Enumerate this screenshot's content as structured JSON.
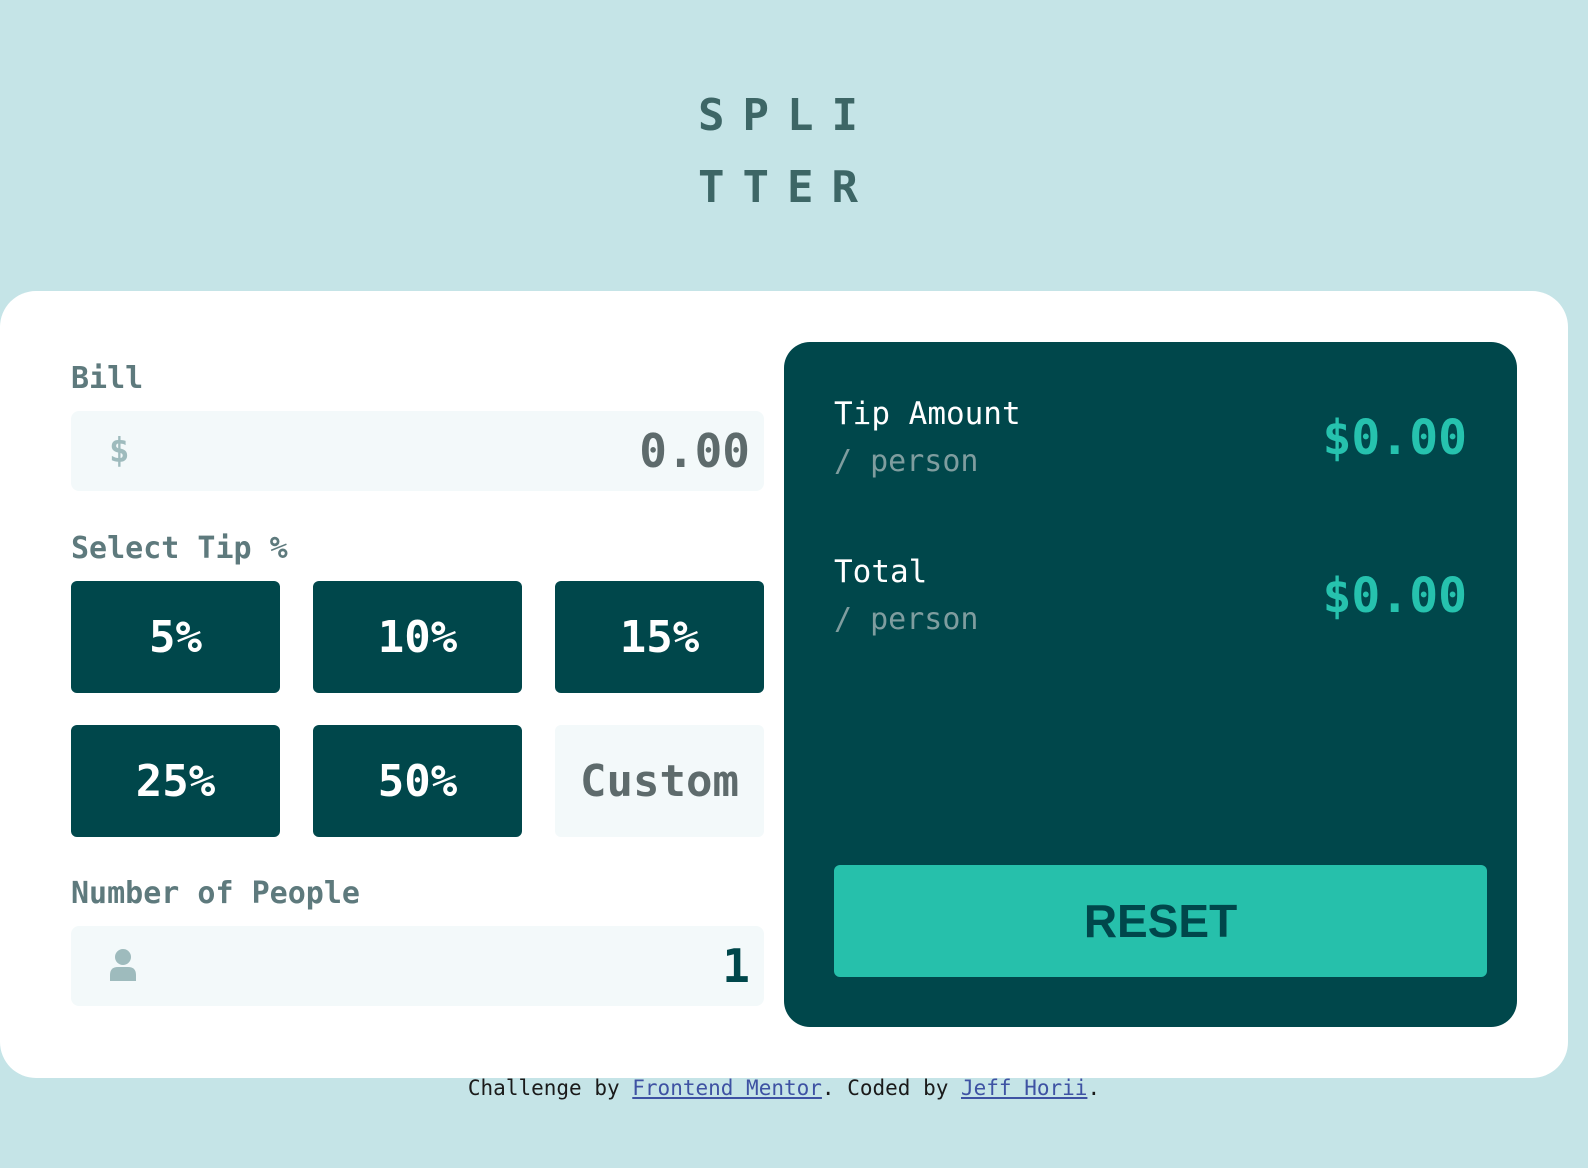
{
  "logo": {
    "line1": "SPLI",
    "line2": "TTER"
  },
  "bill": {
    "label": "Bill",
    "icon": "dollar-icon",
    "icon_glyph": "$",
    "value": "0.00"
  },
  "tip": {
    "label": "Select Tip %",
    "options": [
      "5%",
      "10%",
      "15%",
      "25%",
      "50%"
    ],
    "custom_placeholder": "Custom"
  },
  "people": {
    "label": "Number of People",
    "icon": "person-icon",
    "value": "1"
  },
  "results": {
    "tip_amount": {
      "title": "Tip Amount",
      "sub": "/ person",
      "value": "$0.00"
    },
    "total": {
      "title": "Total",
      "sub": "/ person",
      "value": "$0.00"
    },
    "reset_label": "RESET"
  },
  "footer": {
    "prefix": "Challenge by ",
    "link1": "Frontend Mentor",
    "middle": ". Coded by ",
    "link2": "Jeff Horii",
    "suffix": "."
  },
  "colors": {
    "background": "#c5e4e7",
    "dark_teal": "#00474b",
    "accent": "#26c2ae",
    "label": "#5e7a7d",
    "input_bg": "#f3f9fa"
  }
}
